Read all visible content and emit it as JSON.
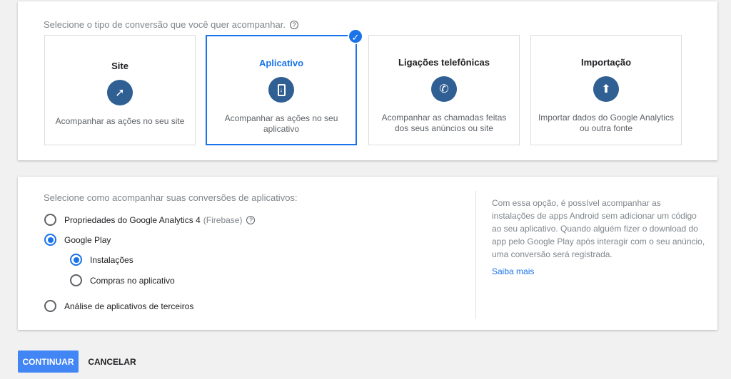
{
  "section1": {
    "prompt": "Selecione o tipo de conversão que você quer acompanhar.",
    "options": [
      {
        "title": "Site",
        "desc": "Acompanhar as ações no seu site",
        "icon": "cursor-click-icon"
      },
      {
        "title": "Aplicativo",
        "desc": "Acompanhar as ações no seu aplicativo",
        "icon": "phone-download-icon",
        "selected": true
      },
      {
        "title": "Ligações telefônicas",
        "desc": "Acompanhar as chamadas feitas dos seus anúncios ou site",
        "icon": "phone-icon"
      },
      {
        "title": "Importação",
        "desc": "Importar dados do Google Analytics ou outra fonte",
        "icon": "upload-icon"
      }
    ]
  },
  "section2": {
    "prompt": "Selecione como acompanhar suas conversões de aplicativos:",
    "radios": {
      "ga4": "Propriedades do Google Analytics 4",
      "ga4_note": "(Firebase)",
      "play": "Google Play",
      "installs": "Instalações",
      "purchases": "Compras no aplicativo",
      "third": "Análise de aplicativos de terceiros"
    },
    "info": "Com essa opção, é possível acompanhar as instalações de apps Android sem adicionar um código ao seu aplicativo. Quando alguém fizer o download do app pelo Google Play após interagir com o seu anúncio, uma conversão será registrada.",
    "learn_more": "Saiba mais"
  },
  "buttons": {
    "continue": "CONTINUAR",
    "cancel": "CANCELAR"
  },
  "colors": {
    "accent": "#1a73e8",
    "icon_bg": "#2f5f93"
  }
}
